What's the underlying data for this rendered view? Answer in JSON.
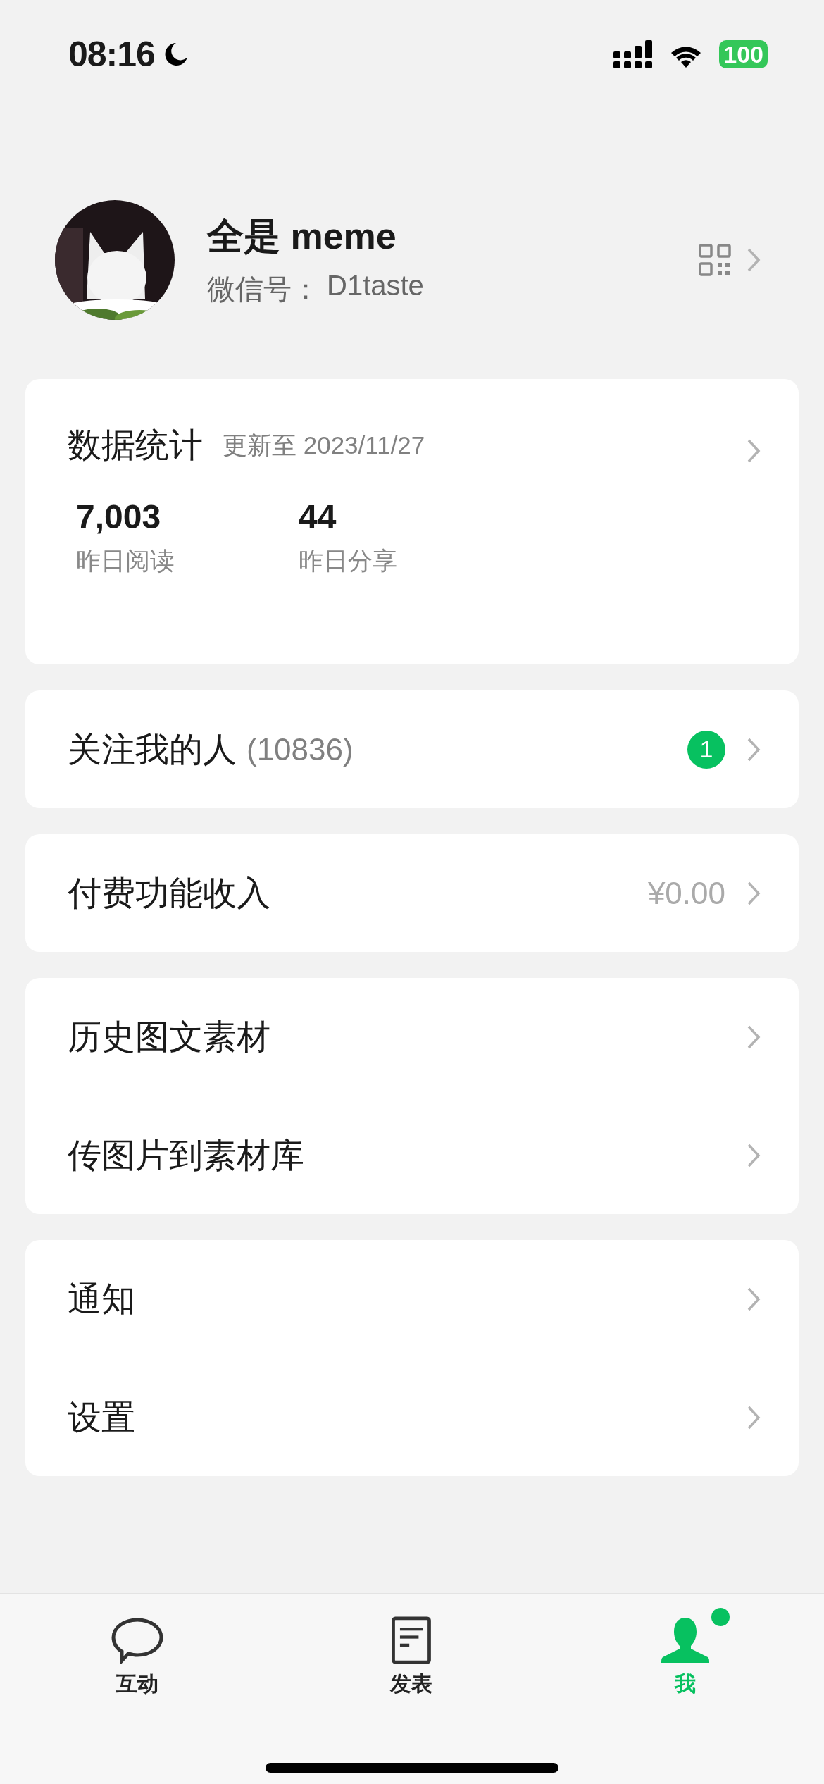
{
  "status_bar": {
    "time": "08:16",
    "battery": "100"
  },
  "profile": {
    "name": "全是 meme",
    "id_label": "微信号：",
    "id_value": "D1taste"
  },
  "stats": {
    "title": "数据统计",
    "updated": "更新至 2023/11/27",
    "metrics": [
      {
        "value": "7,003",
        "label": "昨日阅读"
      },
      {
        "value": "44",
        "label": "昨日分享"
      }
    ]
  },
  "groups": [
    {
      "items": [
        {
          "label": "关注我的人",
          "count": "(10836)",
          "badge": "1"
        }
      ]
    },
    {
      "items": [
        {
          "label": "付费功能收入",
          "value": "¥0.00"
        }
      ]
    },
    {
      "items": [
        {
          "label": "历史图文素材"
        },
        {
          "label": "传图片到素材库"
        }
      ]
    },
    {
      "items": [
        {
          "label": "通知"
        },
        {
          "label": "设置"
        }
      ]
    }
  ],
  "tabs": [
    {
      "kind": "chat",
      "label": "互动",
      "selected": false,
      "dot": false
    },
    {
      "kind": "post",
      "label": "发表",
      "selected": false,
      "dot": false
    },
    {
      "kind": "me",
      "label": "我",
      "selected": true,
      "dot": true
    }
  ]
}
